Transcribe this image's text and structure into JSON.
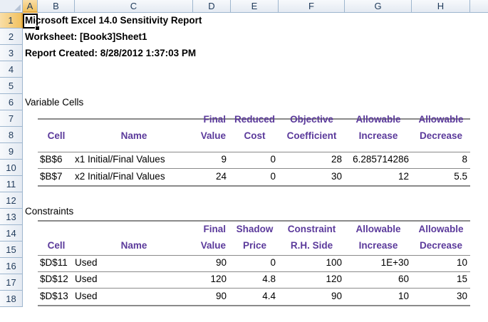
{
  "columns": [
    "A",
    "B",
    "C",
    "D",
    "E",
    "F",
    "G",
    "H"
  ],
  "rows": [
    "1",
    "2",
    "3",
    "4",
    "5",
    "6",
    "7",
    "8",
    "9",
    "10",
    "11",
    "12",
    "13",
    "14",
    "15",
    "16",
    "17",
    "18"
  ],
  "selected_cell": "A1",
  "report": {
    "title": "Microsoft Excel 14.0 Sensitivity Report",
    "worksheet": "Worksheet: [Book3]Sheet1",
    "created": "Report Created: 8/28/2012 1:37:03 PM"
  },
  "variable_cells": {
    "section_label": "Variable Cells",
    "headers_top": [
      "",
      "",
      "Final",
      "Reduced",
      "Objective",
      "Allowable",
      "Allowable"
    ],
    "headers_bottom": [
      "Cell",
      "Name",
      "Value",
      "Cost",
      "Coefficient",
      "Increase",
      "Decrease"
    ],
    "rows": [
      [
        "$B$6",
        "x1 Initial/Final  Values",
        "9",
        "0",
        "28",
        "6.285714286",
        "8"
      ],
      [
        "$B$7",
        "x2 Initial/Final  Values",
        "24",
        "0",
        "30",
        "12",
        "5.5"
      ]
    ]
  },
  "constraints": {
    "section_label": "Constraints",
    "headers_top": [
      "",
      "",
      "Final",
      "Shadow",
      "Constraint",
      "Allowable",
      "Allowable"
    ],
    "headers_bottom": [
      "Cell",
      "Name",
      "Value",
      "Price",
      "R.H. Side",
      "Increase",
      "Decrease"
    ],
    "rows": [
      [
        "$D$11",
        "Used",
        "90",
        "0",
        "100",
        "1E+30",
        "10"
      ],
      [
        "$D$12",
        "Used",
        "120",
        "4.8",
        "120",
        "60",
        "15"
      ],
      [
        "$D$13",
        "Used",
        "90",
        "4.4",
        "90",
        "10",
        "30"
      ]
    ]
  }
}
